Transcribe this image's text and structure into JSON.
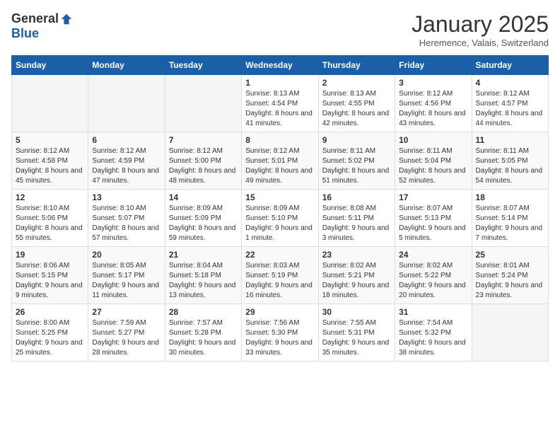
{
  "logo": {
    "general": "General",
    "blue": "Blue"
  },
  "header": {
    "title": "January 2025",
    "location": "Heremence, Valais, Switzerland"
  },
  "weekdays": [
    "Sunday",
    "Monday",
    "Tuesday",
    "Wednesday",
    "Thursday",
    "Friday",
    "Saturday"
  ],
  "weeks": [
    [
      {
        "day": "",
        "info": ""
      },
      {
        "day": "",
        "info": ""
      },
      {
        "day": "",
        "info": ""
      },
      {
        "day": "1",
        "info": "Sunrise: 8:13 AM\nSunset: 4:54 PM\nDaylight: 8 hours and 41 minutes."
      },
      {
        "day": "2",
        "info": "Sunrise: 8:13 AM\nSunset: 4:55 PM\nDaylight: 8 hours and 42 minutes."
      },
      {
        "day": "3",
        "info": "Sunrise: 8:12 AM\nSunset: 4:56 PM\nDaylight: 8 hours and 43 minutes."
      },
      {
        "day": "4",
        "info": "Sunrise: 8:12 AM\nSunset: 4:57 PM\nDaylight: 8 hours and 44 minutes."
      }
    ],
    [
      {
        "day": "5",
        "info": "Sunrise: 8:12 AM\nSunset: 4:58 PM\nDaylight: 8 hours and 45 minutes."
      },
      {
        "day": "6",
        "info": "Sunrise: 8:12 AM\nSunset: 4:59 PM\nDaylight: 8 hours and 47 minutes."
      },
      {
        "day": "7",
        "info": "Sunrise: 8:12 AM\nSunset: 5:00 PM\nDaylight: 8 hours and 48 minutes."
      },
      {
        "day": "8",
        "info": "Sunrise: 8:12 AM\nSunset: 5:01 PM\nDaylight: 8 hours and 49 minutes."
      },
      {
        "day": "9",
        "info": "Sunrise: 8:11 AM\nSunset: 5:02 PM\nDaylight: 8 hours and 51 minutes."
      },
      {
        "day": "10",
        "info": "Sunrise: 8:11 AM\nSunset: 5:04 PM\nDaylight: 8 hours and 52 minutes."
      },
      {
        "day": "11",
        "info": "Sunrise: 8:11 AM\nSunset: 5:05 PM\nDaylight: 8 hours and 54 minutes."
      }
    ],
    [
      {
        "day": "12",
        "info": "Sunrise: 8:10 AM\nSunset: 5:06 PM\nDaylight: 8 hours and 55 minutes."
      },
      {
        "day": "13",
        "info": "Sunrise: 8:10 AM\nSunset: 5:07 PM\nDaylight: 8 hours and 57 minutes."
      },
      {
        "day": "14",
        "info": "Sunrise: 8:09 AM\nSunset: 5:09 PM\nDaylight: 8 hours and 59 minutes."
      },
      {
        "day": "15",
        "info": "Sunrise: 8:09 AM\nSunset: 5:10 PM\nDaylight: 9 hours and 1 minute."
      },
      {
        "day": "16",
        "info": "Sunrise: 8:08 AM\nSunset: 5:11 PM\nDaylight: 9 hours and 3 minutes."
      },
      {
        "day": "17",
        "info": "Sunrise: 8:07 AM\nSunset: 5:13 PM\nDaylight: 9 hours and 5 minutes."
      },
      {
        "day": "18",
        "info": "Sunrise: 8:07 AM\nSunset: 5:14 PM\nDaylight: 9 hours and 7 minutes."
      }
    ],
    [
      {
        "day": "19",
        "info": "Sunrise: 8:06 AM\nSunset: 5:15 PM\nDaylight: 9 hours and 9 minutes."
      },
      {
        "day": "20",
        "info": "Sunrise: 8:05 AM\nSunset: 5:17 PM\nDaylight: 9 hours and 11 minutes."
      },
      {
        "day": "21",
        "info": "Sunrise: 8:04 AM\nSunset: 5:18 PM\nDaylight: 9 hours and 13 minutes."
      },
      {
        "day": "22",
        "info": "Sunrise: 8:03 AM\nSunset: 5:19 PM\nDaylight: 9 hours and 16 minutes."
      },
      {
        "day": "23",
        "info": "Sunrise: 8:02 AM\nSunset: 5:21 PM\nDaylight: 9 hours and 18 minutes."
      },
      {
        "day": "24",
        "info": "Sunrise: 8:02 AM\nSunset: 5:22 PM\nDaylight: 9 hours and 20 minutes."
      },
      {
        "day": "25",
        "info": "Sunrise: 8:01 AM\nSunset: 5:24 PM\nDaylight: 9 hours and 23 minutes."
      }
    ],
    [
      {
        "day": "26",
        "info": "Sunrise: 8:00 AM\nSunset: 5:25 PM\nDaylight: 9 hours and 25 minutes."
      },
      {
        "day": "27",
        "info": "Sunrise: 7:59 AM\nSunset: 5:27 PM\nDaylight: 9 hours and 28 minutes."
      },
      {
        "day": "28",
        "info": "Sunrise: 7:57 AM\nSunset: 5:28 PM\nDaylight: 9 hours and 30 minutes."
      },
      {
        "day": "29",
        "info": "Sunrise: 7:56 AM\nSunset: 5:30 PM\nDaylight: 9 hours and 33 minutes."
      },
      {
        "day": "30",
        "info": "Sunrise: 7:55 AM\nSunset: 5:31 PM\nDaylight: 9 hours and 35 minutes."
      },
      {
        "day": "31",
        "info": "Sunrise: 7:54 AM\nSunset: 5:32 PM\nDaylight: 9 hours and 38 minutes."
      },
      {
        "day": "",
        "info": ""
      }
    ]
  ]
}
